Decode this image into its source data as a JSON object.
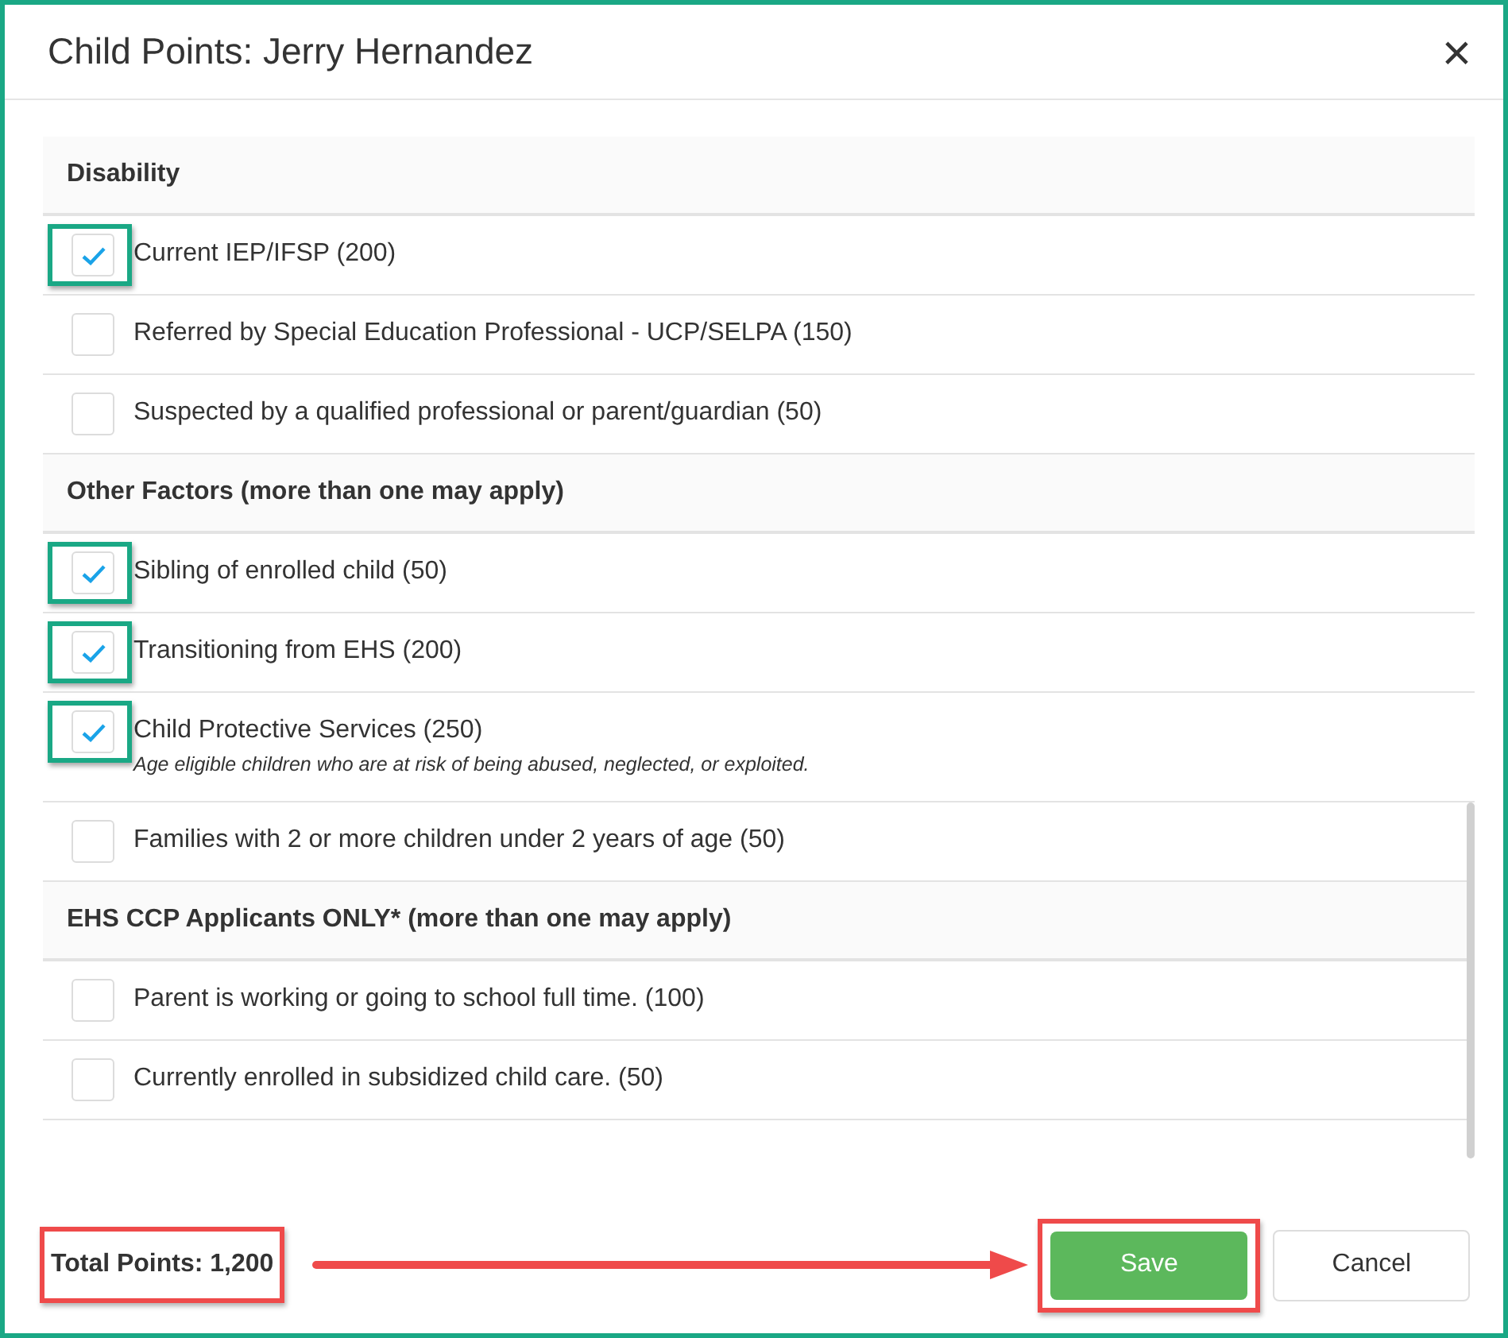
{
  "dialog": {
    "title": "Child Points: Jerry Hernandez",
    "close": "×"
  },
  "sections": [
    {
      "heading": "Disability",
      "items": [
        {
          "label": "Current IEP/IFSP (200)",
          "checked": true
        },
        {
          "label": "Referred by Special Education Professional - UCP/SELPA (150)",
          "checked": false
        },
        {
          "label": "Suspected by a qualified professional or parent/guardian (50)",
          "checked": false
        }
      ]
    },
    {
      "heading": "Other Factors (more than one may apply)",
      "items": [
        {
          "label": "Sibling of enrolled child (50)",
          "checked": true
        },
        {
          "label": "Transitioning from EHS (200)",
          "checked": true
        },
        {
          "label": "Child Protective Services (250)",
          "checked": true,
          "note": "Age eligible children who are at risk of being abused, neglected, or exploited."
        },
        {
          "label": "Families with 2 or more children under 2 years of age (50)",
          "checked": false
        }
      ]
    },
    {
      "heading": "EHS CCP Applicants ONLY* (more than one may apply)",
      "items": [
        {
          "label": "Parent is working or going to school full time. (100)",
          "checked": false
        },
        {
          "label": "Currently enrolled in subsidized child care. (50)",
          "checked": false
        }
      ]
    }
  ],
  "footer": {
    "total": "Total Points: 1,200",
    "total_highlighted": true,
    "save": "Save",
    "save_highlighted": true,
    "cancel": "Cancel"
  }
}
